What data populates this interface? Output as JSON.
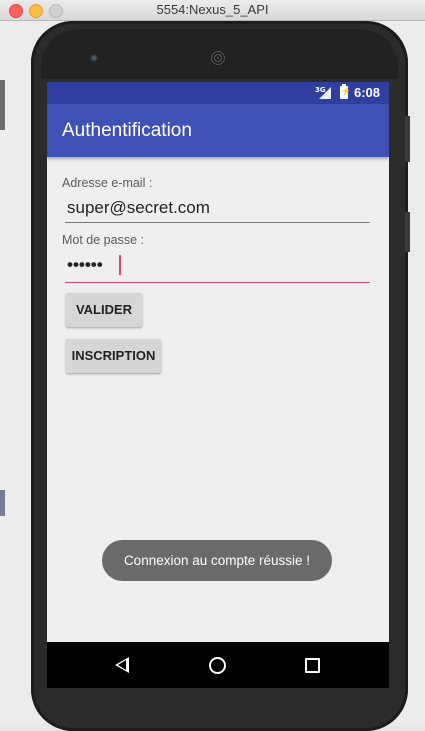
{
  "window": {
    "title": "5554:Nexus_5_API"
  },
  "status_bar": {
    "network": "3G",
    "time": "6:08"
  },
  "app_bar": {
    "title": "Authentification"
  },
  "form": {
    "email_label": "Adresse e-mail :",
    "email_value": "super@secret.com",
    "password_label": "Mot de passe :",
    "password_value": "••••••"
  },
  "buttons": {
    "validate_label": "VALIDER",
    "signup_label": "INSCRIPTION"
  },
  "toast": {
    "message": "Connexion au compte réussie !"
  },
  "nav_icons": [
    "back-icon",
    "home-icon",
    "recent-apps-icon"
  ],
  "colors": {
    "status_bar": "#303f9f",
    "app_bar": "#3f51b5",
    "accent": "#e0457b"
  }
}
